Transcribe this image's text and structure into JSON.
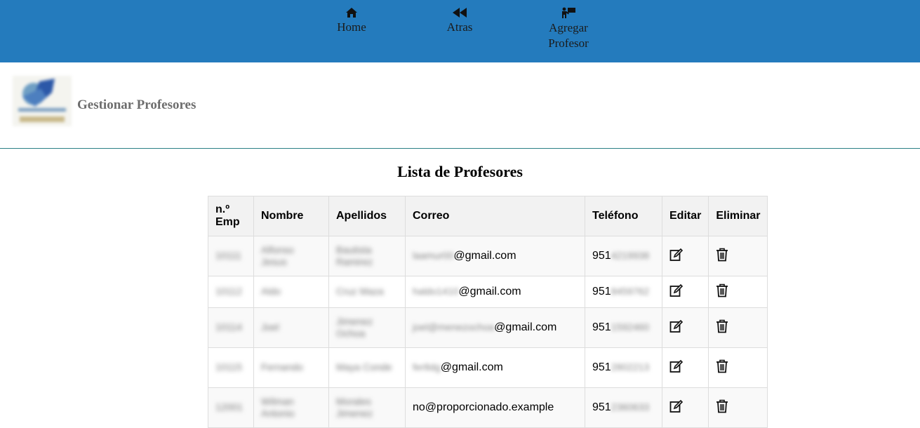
{
  "nav": {
    "home_label": "Home",
    "back_label": "Atras",
    "add_label_line1": "Agregar",
    "add_label_line2": "Profesor",
    "home_icon": "home-icon",
    "back_icon": "rewind-icon",
    "add_icon": "teacher-board-icon"
  },
  "header": {
    "title": "Gestionar Profesores"
  },
  "main": {
    "list_title": "Lista de Profesores"
  },
  "table": {
    "headers": [
      "n.º Emp",
      "Nombre",
      "Apellidos",
      "Correo",
      "Teléfono",
      "Editar",
      "Eliminar"
    ],
    "header_emp_line1": "n.º",
    "header_emp_line2": "Emp",
    "rows": [
      {
        "emp": "10111",
        "nombre": "Alfonso Jesus",
        "apellidos": "Bautista Ramirez",
        "correo_user": "laamur00",
        "correo_domain": "@gmail.com",
        "tel_prefix": "951",
        "tel_rest": "4219938"
      },
      {
        "emp": "10112",
        "nombre": "Aldo",
        "apellidos": "Cruz Maza",
        "correo_user": "haldo1410",
        "correo_domain": "@gmail.com",
        "tel_prefix": "951",
        "tel_rest": "8459762"
      },
      {
        "emp": "10114",
        "nombre": "Joel",
        "apellidos": "Jimenez Ochoa",
        "correo_user": "joel@menezochoa",
        "correo_domain": "@gmail.com",
        "tel_prefix": "951",
        "tel_rest": "1592460"
      },
      {
        "emp": "10115",
        "nombre": "Fernando",
        "apellidos": "Maya Conde",
        "correo_user": "fer8dg",
        "correo_domain": "@gmail.com",
        "tel_prefix": "951",
        "tel_rest": "2802213"
      },
      {
        "emp": "12001",
        "nombre": "Wilman Antonio",
        "apellidos": "Morales Jimenez",
        "correo_user": "",
        "correo_domain": "no@proporcionado.example",
        "tel_prefix": "951",
        "tel_rest": "2360633"
      }
    ]
  },
  "colors": {
    "nav_bg": "#247bbd",
    "header_border": "#2a7f86",
    "header_text": "#6d6d6d"
  }
}
